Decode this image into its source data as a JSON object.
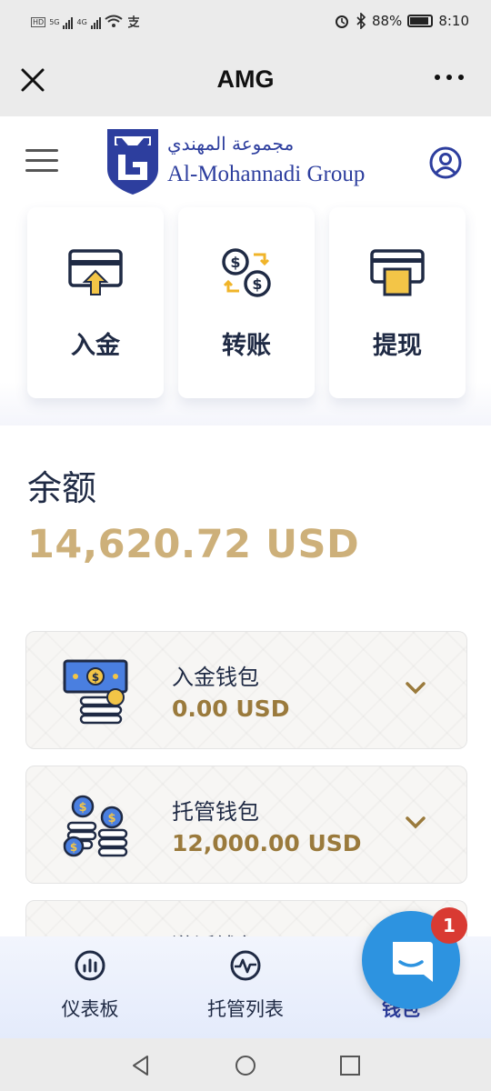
{
  "status_bar": {
    "signal_left_top": "HD",
    "signal_left_bottom": "HD",
    "net1": "5G",
    "net2": "4G",
    "battery": "88%",
    "time": "8:10"
  },
  "title_bar": {
    "title": "AMG"
  },
  "header": {
    "logo_arabic": "مجموعة المهندي",
    "logo_name": "Al-Mohannadi Group"
  },
  "actions": [
    {
      "label": "入金",
      "icon": "deposit-icon"
    },
    {
      "label": "转账",
      "icon": "transfer-icon"
    },
    {
      "label": "提现",
      "icon": "withdraw-icon"
    }
  ],
  "balance": {
    "label": "余额",
    "value": "14,620.72 USD"
  },
  "wallets": [
    {
      "name": "入金钱包",
      "amount": "0.00 USD"
    },
    {
      "name": "托管钱包",
      "amount": "12,000.00 USD"
    },
    {
      "name": "激活钱包",
      "amount": ""
    }
  ],
  "bottom_nav": [
    {
      "label": "仪表板",
      "icon": "dashboard-icon"
    },
    {
      "label": "托管列表",
      "icon": "pulse-icon"
    },
    {
      "label": "钱包",
      "icon": "wallet-icon"
    }
  ],
  "chat": {
    "badge": "1"
  },
  "colors": {
    "accent_gold": "#cdb07a",
    "amount_gold": "#9a7a3c",
    "navy": "#1f2a44",
    "brand_blue": "#2d3e9e",
    "chat_blue": "#2d93e0",
    "badge_red": "#d93a32"
  }
}
